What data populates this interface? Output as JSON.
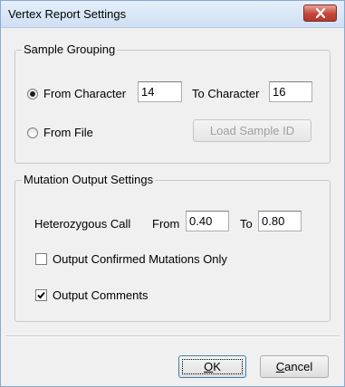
{
  "window": {
    "title": "Vertex Report Settings"
  },
  "sample_grouping": {
    "legend": "Sample Grouping",
    "from_character_label": "From Character",
    "from_character_value": "14",
    "to_character_label": "To Character",
    "to_character_value": "16",
    "from_file_label": "From File",
    "load_sample_id_label": "Load Sample ID",
    "selected_option": "From Character"
  },
  "mutation_output": {
    "legend": "Mutation Output Settings",
    "heterozygous_label": "Heterozygous Call",
    "from_label": "From",
    "from_value": "0.40",
    "to_label": "To",
    "to_value": "0.80",
    "confirmed_only_label": "Output Confirmed Mutations Only",
    "confirmed_only_checked": false,
    "comments_label": "Output Comments",
    "comments_checked": true
  },
  "footer": {
    "ok_mnemonic": "O",
    "ok_rest": "K",
    "cancel_mnemonic": "C",
    "cancel_rest": "ancel"
  },
  "colors": {
    "close_button": "#c4453a",
    "titlebar": "#dbe8f7",
    "dialog_bg": "#f0f0f0"
  }
}
